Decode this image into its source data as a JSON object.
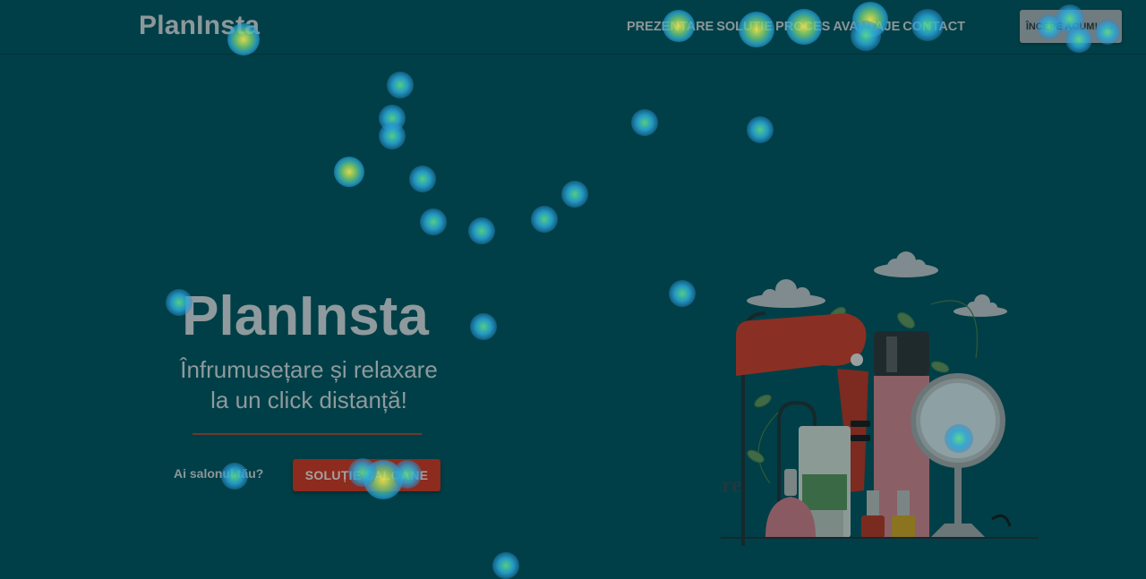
{
  "header": {
    "logo": "PlanInsta",
    "nav": [
      "PREZENTARE",
      "SOLUȚIE",
      "PROCES",
      "AVANTAJE",
      "CONTACT"
    ],
    "cta_label": "ÎNCEPE ACUM!",
    "cta_icon": "arrow-right-icon"
  },
  "hero": {
    "title": "PlanInsta",
    "subtitle_line1": "Înfrumusețare și relaxare",
    "subtitle_line2": "la un click distanță!",
    "salon_question": "Ai salonul tău?",
    "salon_button": "SOLUȚIE SALOANE"
  },
  "illustration": {
    "text": "re"
  },
  "colors": {
    "background": "#003f47",
    "accent_red": "#8d2b1e",
    "cta_grey": "#6f7c80",
    "heat_blue": "#2aa8d8",
    "heat_yellow": "#e8e04a"
  }
}
